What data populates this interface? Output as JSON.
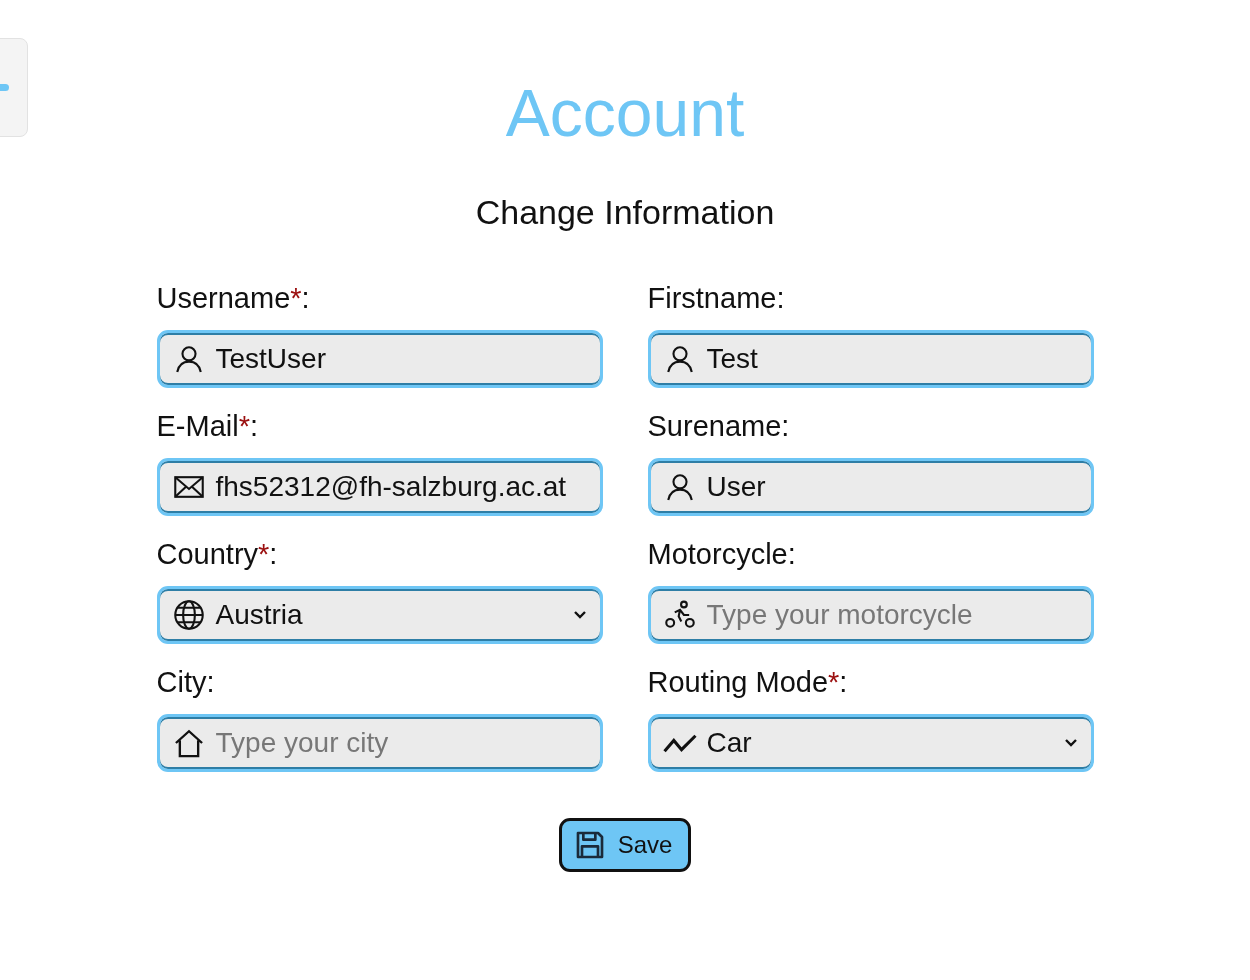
{
  "title": "Account",
  "section_title": "Change Information",
  "fields": [
    {
      "label": "Username",
      "required_mark": "*",
      "label_end": ":",
      "kind": "input",
      "value": "TestUser"
    },
    {
      "label": "Firstname",
      "label_end": ":",
      "kind": "input",
      "value": "Test"
    },
    {
      "label": "E-Mail",
      "required_mark": "*",
      "label_end": ":",
      "kind": "input",
      "value": "fhs52312@fh-salzburg.ac.at"
    },
    {
      "label": "Surename",
      "label_end": ":",
      "kind": "input",
      "value": "User"
    },
    {
      "label": "Country",
      "required_mark": "*",
      "label_end": ":",
      "kind": "select",
      "value": "Austria"
    },
    {
      "label": "Motorcycle",
      "label_end": ":",
      "kind": "input",
      "placeholder": "Type your motorcycle"
    },
    {
      "label": "City",
      "label_end": ":",
      "kind": "input",
      "placeholder": "Type your city"
    },
    {
      "label": "Routing Mode",
      "required_mark": "*",
      "label_end": ":",
      "kind": "select",
      "value": "Car"
    }
  ],
  "save_button": {
    "label": "Save"
  }
}
